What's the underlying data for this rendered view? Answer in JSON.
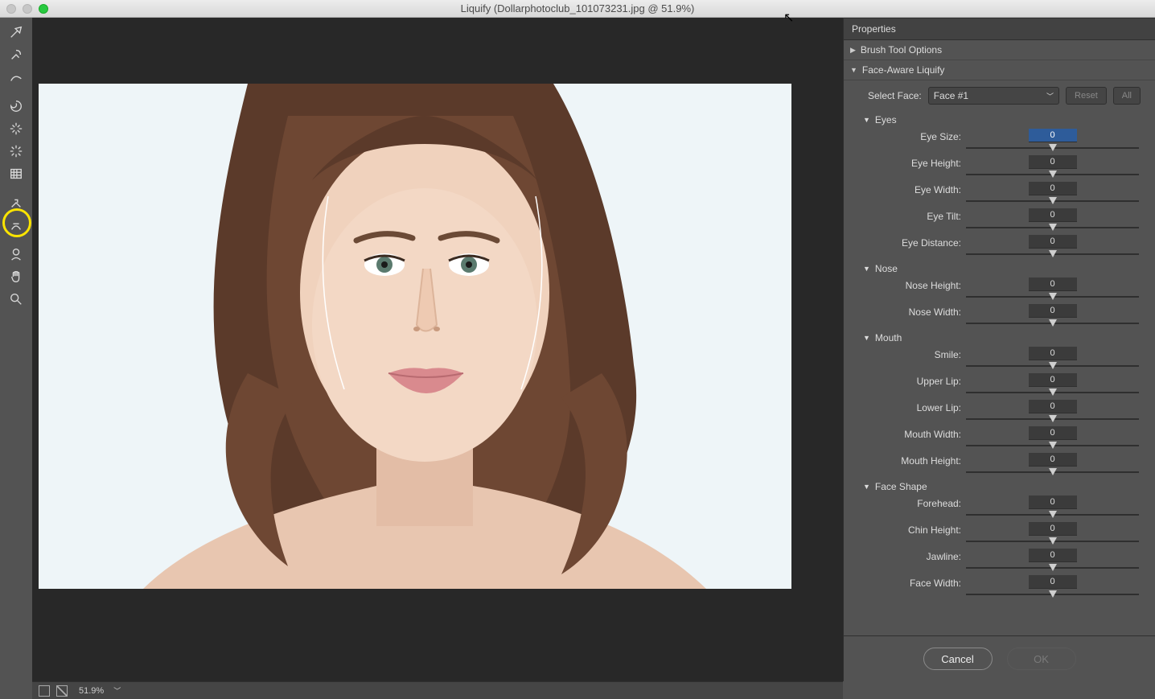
{
  "window": {
    "title": "Liquify (Dollarphotoclub_101073231.jpg @ 51.9%)"
  },
  "toolbar": {
    "tools": [
      "forward-warp",
      "reconstruct",
      "smooth",
      "twirl",
      "pucker",
      "bloat",
      "push-left",
      "freeze-mask",
      "thaw-mask",
      "face",
      "hand",
      "zoom"
    ]
  },
  "statusbar": {
    "zoom": "51.9%"
  },
  "panel": {
    "title": "Properties",
    "brush_section": "Brush Tool Options",
    "face_section": "Face-Aware Liquify",
    "select_face_label": "Select Face:",
    "select_face_value": "Face #1",
    "reset_label": "Reset",
    "all_label": "All",
    "groups": {
      "eyes": {
        "label": "Eyes"
      },
      "nose": {
        "label": "Nose"
      },
      "mouth": {
        "label": "Mouth"
      },
      "face_shape": {
        "label": "Face Shape"
      }
    },
    "sliders": {
      "eye_size": {
        "label": "Eye Size:",
        "value": "0",
        "selected": true
      },
      "eye_height": {
        "label": "Eye Height:",
        "value": "0"
      },
      "eye_width": {
        "label": "Eye Width:",
        "value": "0"
      },
      "eye_tilt": {
        "label": "Eye Tilt:",
        "value": "0"
      },
      "eye_distance": {
        "label": "Eye Distance:",
        "value": "0"
      },
      "nose_height": {
        "label": "Nose Height:",
        "value": "0"
      },
      "nose_width": {
        "label": "Nose Width:",
        "value": "0"
      },
      "smile": {
        "label": "Smile:",
        "value": "0"
      },
      "upper_lip": {
        "label": "Upper Lip:",
        "value": "0"
      },
      "lower_lip": {
        "label": "Lower Lip:",
        "value": "0"
      },
      "mouth_width": {
        "label": "Mouth Width:",
        "value": "0"
      },
      "mouth_height": {
        "label": "Mouth Height:",
        "value": "0"
      },
      "forehead": {
        "label": "Forehead:",
        "value": "0"
      },
      "chin_height": {
        "label": "Chin Height:",
        "value": "0"
      },
      "jawline": {
        "label": "Jawline:",
        "value": "0"
      },
      "face_width": {
        "label": "Face Width:",
        "value": "0"
      }
    },
    "cancel_label": "Cancel",
    "ok_label": "OK"
  }
}
